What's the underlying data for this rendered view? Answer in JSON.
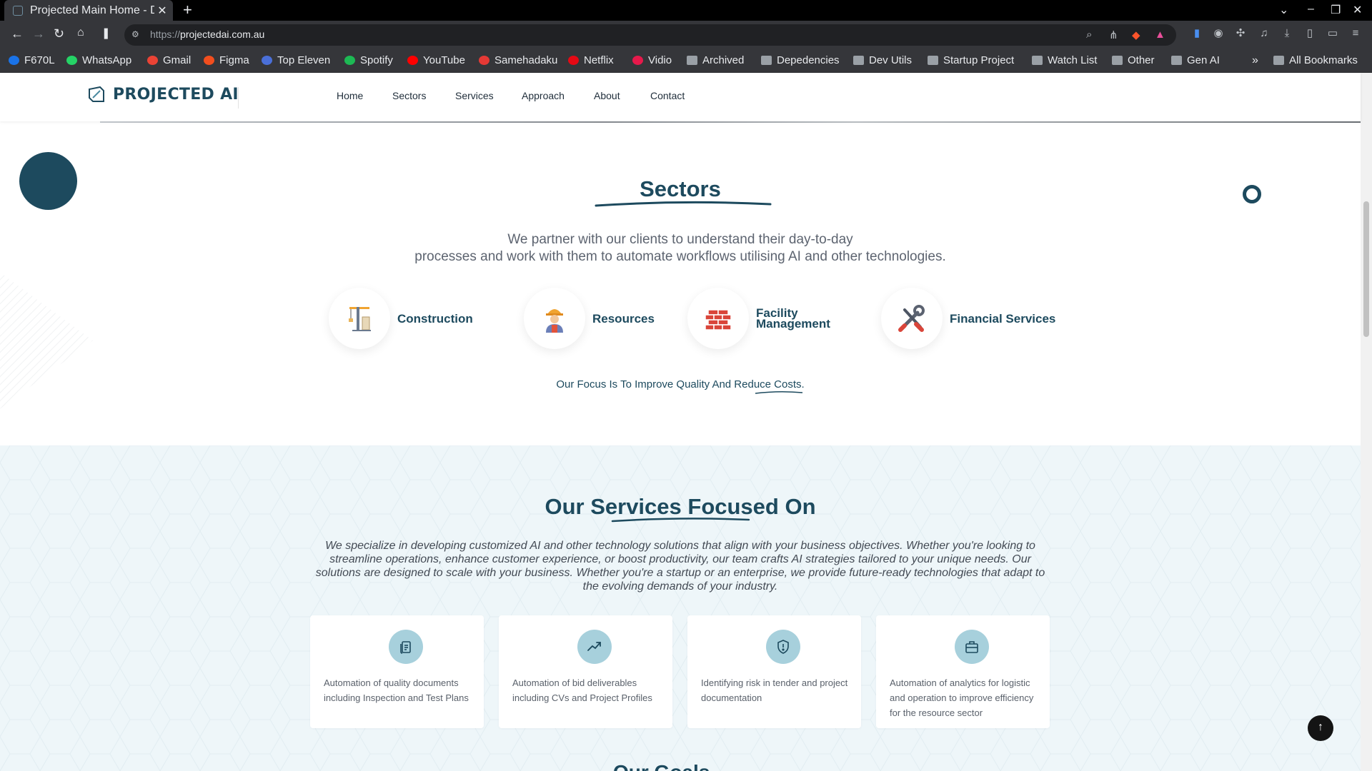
{
  "browser": {
    "tab_title": "Projected Main Home - De",
    "url_protocol": "https://",
    "url_host": "projectedai.com.au",
    "bookmarks": [
      {
        "label": "F670L",
        "icon": "zte-icon",
        "color": "#1a73e8"
      },
      {
        "label": "WhatsApp",
        "icon": "whatsapp-icon",
        "color": "#25d366"
      },
      {
        "label": "Gmail",
        "icon": "gmail-icon",
        "color": "#ea4335"
      },
      {
        "label": "Figma",
        "icon": "figma-icon",
        "color": "#f24e1e"
      },
      {
        "label": "Top Eleven",
        "icon": "top-eleven-icon",
        "color": "#4a6fd8"
      },
      {
        "label": "Spotify",
        "icon": "spotify-icon",
        "color": "#1db954"
      },
      {
        "label": "YouTube",
        "icon": "youtube-icon",
        "color": "#ff0000"
      },
      {
        "label": "Samehadaku",
        "icon": "samehadaku-icon",
        "color": "#e53935"
      },
      {
        "label": "Netflix",
        "icon": "netflix-icon",
        "color": "#e50914"
      },
      {
        "label": "Vidio",
        "icon": "vidio-icon",
        "color": "#e6194b"
      },
      {
        "label": "Archived",
        "icon": "folder-icon",
        "color": "#9aa0a6"
      },
      {
        "label": "Depedencies",
        "icon": "folder-icon",
        "color": "#9aa0a6"
      },
      {
        "label": "Dev Utils",
        "icon": "folder-icon",
        "color": "#9aa0a6"
      },
      {
        "label": "Startup Project",
        "icon": "folder-icon",
        "color": "#9aa0a6"
      },
      {
        "label": "Watch List",
        "icon": "folder-icon",
        "color": "#9aa0a6"
      },
      {
        "label": "Other",
        "icon": "folder-icon",
        "color": "#9aa0a6"
      },
      {
        "label": "Gen AI",
        "icon": "folder-icon",
        "color": "#9aa0a6"
      }
    ],
    "bookmarks_more": "»",
    "all_bookmarks": "All Bookmarks"
  },
  "site": {
    "logo_text": "PROJECTED AI",
    "nav": [
      "Home",
      "Sectors",
      "Services",
      "Approach",
      "About",
      "Contact"
    ],
    "brand_color": "#1d4a5e"
  },
  "sectors": {
    "title": "Sectors",
    "intro_line1": "We partner with our clients to understand their day-to-day",
    "intro_line2": "processes and work with them to automate workflows utilising AI and other technologies.",
    "items": [
      {
        "label": "Construction",
        "icon": "construction-crane-icon"
      },
      {
        "label": "Resources",
        "icon": "worker-icon"
      },
      {
        "label_line1": "Facility",
        "label_line2": "Management",
        "icon": "bricks-icon"
      },
      {
        "label": "Financial Services",
        "icon": "tools-icon"
      }
    ],
    "focus": "Our Focus Is To Improve Quality And Reduce Costs."
  },
  "services": {
    "title": "Our Services Focused On",
    "intro": "We specialize in developing customized AI and other technology solutions that align with your business objectives. Whether you're looking to streamline operations, enhance customer experience, or boost productivity, our team crafts AI strategies tailored to your unique needs. Our solutions are designed to scale with your business. Whether you're a startup or an enterprise, we provide future-ready technologies that adapt to the evolving demands of your industry.",
    "cards": [
      {
        "text": "Automation of quality documents including Inspection and Test Plans",
        "icon": "documents-icon"
      },
      {
        "text": "Automation of bid deliverables including CVs and Project Profiles",
        "icon": "trending-up-icon"
      },
      {
        "text": "Identifying risk in tender and project documentation",
        "icon": "shield-alert-icon"
      },
      {
        "text": "Automation of analytics for logistic and operation to improve efficiency for the resource sector",
        "icon": "briefcase-icon"
      }
    ],
    "next_section_title": "Our Goals"
  },
  "back_to_top": "↑"
}
